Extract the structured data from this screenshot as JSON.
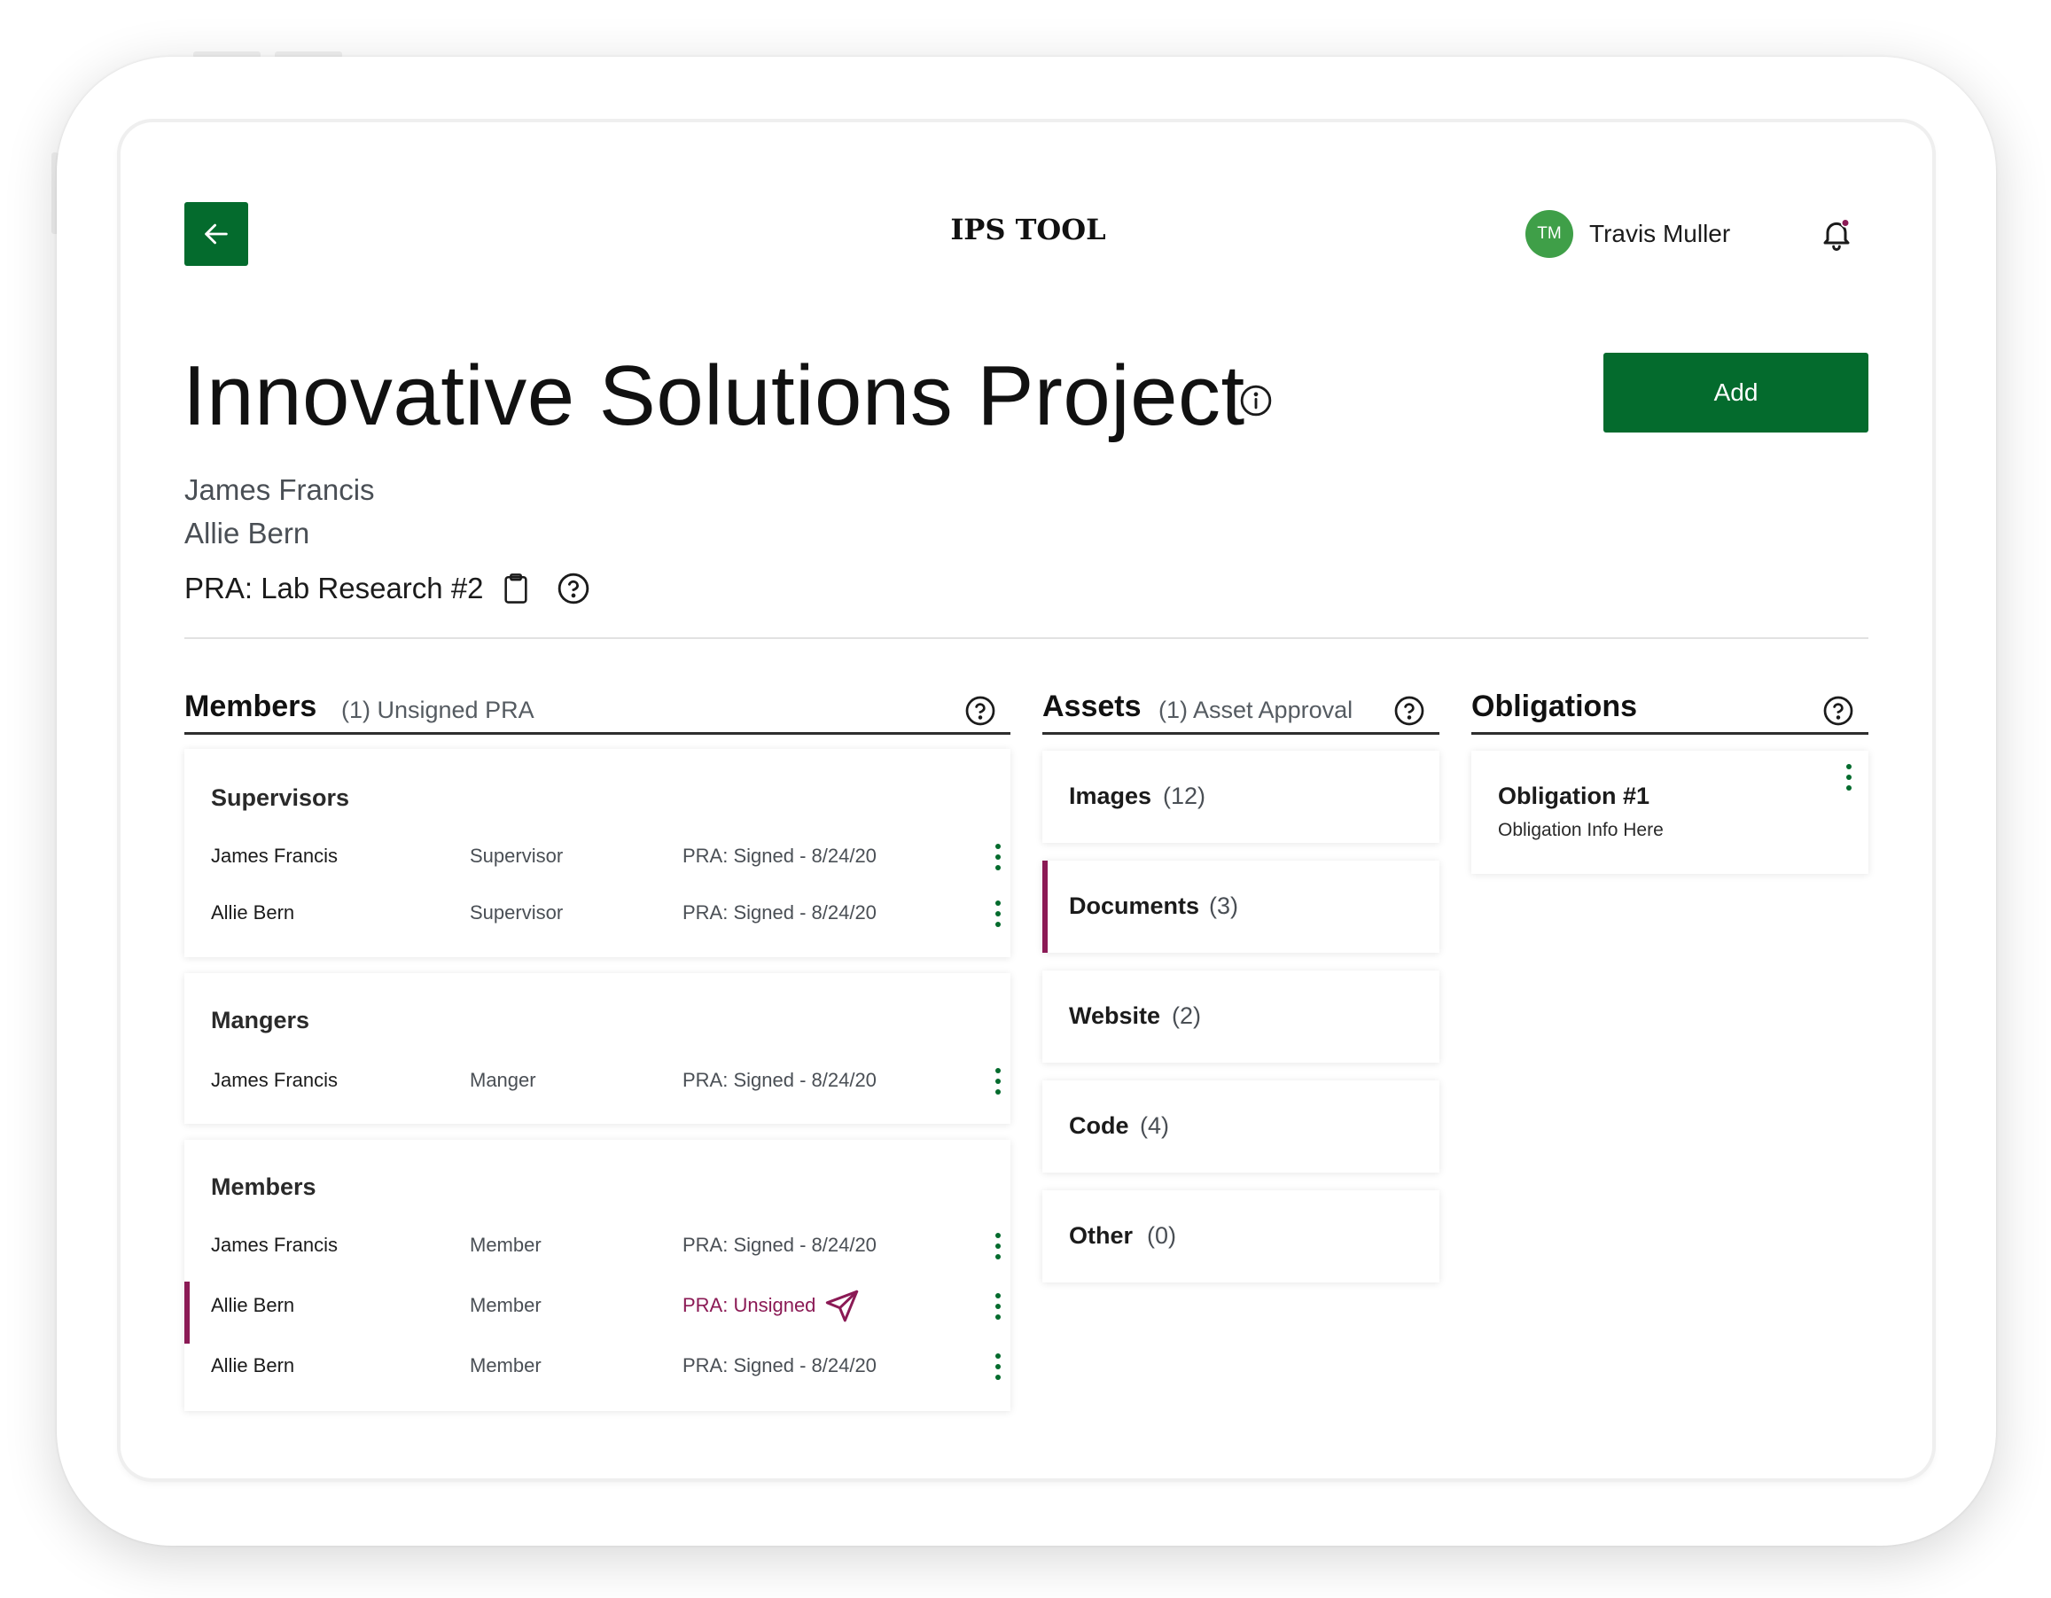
{
  "header": {
    "app_title": "IPS TOOL",
    "user": {
      "initials": "TM",
      "name": "Travis Muller"
    }
  },
  "project": {
    "title": "Innovative Solutions Project",
    "people": [
      "James Francis",
      "Allie Bern"
    ],
    "pra": "PRA: Lab Research #2",
    "add_label": "Add"
  },
  "colors": {
    "primary": "#046b2d",
    "accent": "#8b1a55",
    "avatar": "#3f9f48"
  },
  "members": {
    "title": "Members",
    "subtitle": "(1) Unsigned PRA",
    "groups": [
      {
        "title": "Supervisors",
        "rows": [
          {
            "name": "James Francis",
            "role": "Supervisor",
            "status": "PRA: Signed - 8/24/20"
          },
          {
            "name": "Allie Bern",
            "role": "Supervisor",
            "status": "PRA: Signed - 8/24/20"
          }
        ]
      },
      {
        "title": "Mangers",
        "rows": [
          {
            "name": "James Francis",
            "role": "Manger",
            "status": "PRA: Signed - 8/24/20"
          }
        ]
      },
      {
        "title": "Members",
        "rows": [
          {
            "name": "James Francis",
            "role": "Member",
            "status": "PRA: Signed - 8/24/20"
          },
          {
            "name": "Allie Bern",
            "role": "Member",
            "status": "PRA: Unsigned"
          },
          {
            "name": "Allie Bern",
            "role": "Member",
            "status": "PRA: Signed - 8/24/20"
          }
        ]
      }
    ]
  },
  "assets": {
    "title": "Assets",
    "subtitle": "(1) Asset Approval",
    "items": [
      {
        "label": "Images",
        "count": "(12)"
      },
      {
        "label": "Documents",
        "count": "(3)"
      },
      {
        "label": "Website",
        "count": "(2)"
      },
      {
        "label": "Code",
        "count": "(4)"
      },
      {
        "label": "Other",
        "count": "(0)"
      }
    ]
  },
  "obligations": {
    "title": "Obligations",
    "items": [
      {
        "title": "Obligation #1",
        "info": "Obligation Info Here"
      }
    ]
  }
}
